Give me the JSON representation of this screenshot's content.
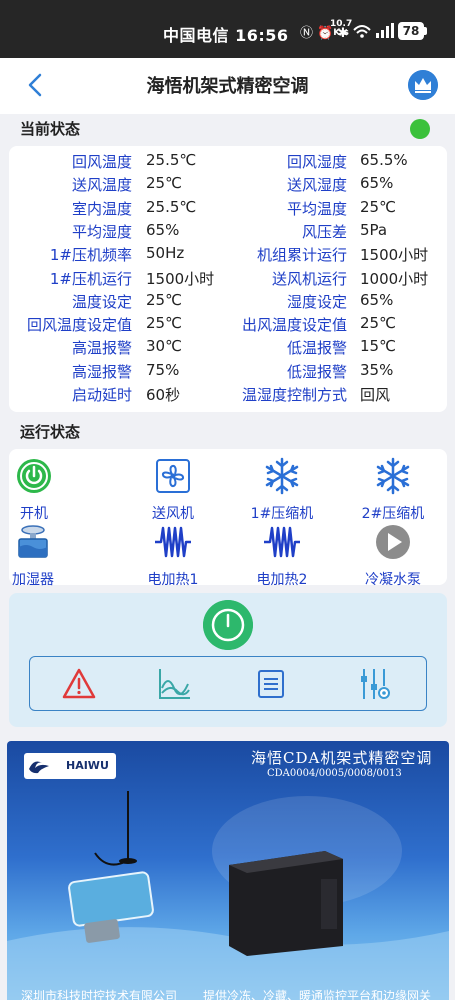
{
  "statusbar": {
    "carrier": "中国电信 16:56",
    "net_speed": "10.7",
    "net_unit": "K/s",
    "battery": "78"
  },
  "header": {
    "title": "海悟机架式精密空调"
  },
  "current_status": {
    "label": "当前状态",
    "indicator_color": "#3bc13b",
    "rows": [
      {
        "l1": "回风温度",
        "v1": "25.5℃",
        "l2": "回风湿度",
        "v2": "65.5%"
      },
      {
        "l1": "送风温度",
        "v1": "25℃",
        "l2": "送风湿度",
        "v2": "65%"
      },
      {
        "l1": "室内温度",
        "v1": "25.5℃",
        "l2": "平均温度",
        "v2": "25℃"
      },
      {
        "l1": "平均湿度",
        "v1": "65%",
        "l2": "风压差",
        "v2": "5Pa"
      },
      {
        "l1": "1#压机频率",
        "v1": "50Hz",
        "l2": "机组累计运行",
        "v2": "1500小时"
      },
      {
        "l1": "1#压机运行",
        "v1": "1500小时",
        "l2": "送风机运行",
        "v2": "1000小时"
      },
      {
        "l1": "温度设定",
        "v1": "25℃",
        "l2": "湿度设定",
        "v2": "65%"
      },
      {
        "l1": "回风温度设定值",
        "v1": "25℃",
        "l2": "出风温度设定值",
        "v2": "25℃"
      },
      {
        "l1": "高温报警",
        "v1": "30℃",
        "l2": "低温报警",
        "v2": "15℃"
      },
      {
        "l1": "高湿报警",
        "v1": "75%",
        "l2": "低湿报警",
        "v2": "35%"
      },
      {
        "l1": "启动延时",
        "v1": "60秒",
        "l2": "温湿度控制方式",
        "v2": "回风"
      }
    ]
  },
  "operation_status": {
    "label": "运行状态",
    "items": [
      {
        "label": "开机",
        "icon": "power-on-icon"
      },
      {
        "label": "送风机",
        "icon": "fan-icon"
      },
      {
        "label": "1#压缩机",
        "icon": "snowflake-icon"
      },
      {
        "label": "2#压缩机",
        "icon": "snowflake-icon"
      },
      {
        "label": "加湿器",
        "icon": "humidifier-icon"
      },
      {
        "label": "电加热1",
        "icon": "heater-icon"
      },
      {
        "label": "电加热2",
        "icon": "heater-icon"
      },
      {
        "label": "冷凝水泵",
        "icon": "pump-icon"
      }
    ]
  },
  "controls": {
    "power_icon": "power-icon",
    "tools": [
      "warning-icon",
      "chart-icon",
      "list-icon",
      "settings-sliders-icon"
    ]
  },
  "banner": {
    "brand": "HAIWU",
    "title": "海悟CDA机架式精密空调",
    "model": "CDA0004/0005/0008/0013",
    "footer_left": "深圳市科技时控技术有限公司",
    "footer_right": "提供冷冻、冷藏、暖通监控平台和边缘网关"
  }
}
